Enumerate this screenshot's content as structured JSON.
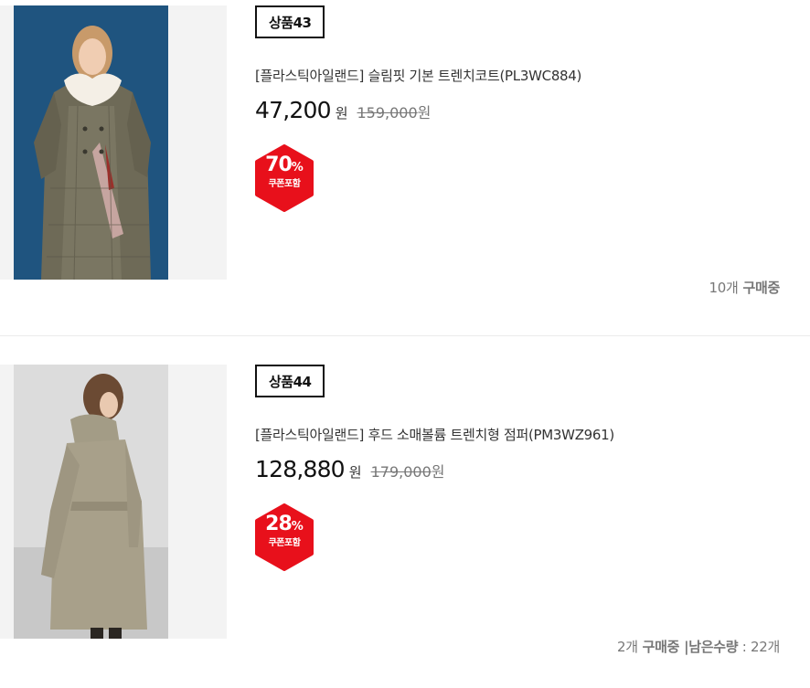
{
  "products": [
    {
      "badge": "상품43",
      "name": "[플라스틱아일랜드] 슬림핏 기본 트렌치코트(PL3WC884)",
      "price": "47,200",
      "currency": "원",
      "original_price": "159,000",
      "original_currency": "원",
      "discount_value": "70",
      "discount_unit": "%",
      "discount_note": "쿠폰포함",
      "sold_count": "10개",
      "sold_label": "구매중",
      "image_icon": "product-photo-trench-coat-plaid"
    },
    {
      "badge": "상품44",
      "name": "[플라스틱아일랜드] 후드 소매볼륨 트렌치형 점퍼(PM3WZ961)",
      "price": "128,880",
      "currency": "원",
      "original_price": "179,000",
      "original_currency": "원",
      "discount_value": "28",
      "discount_unit": "%",
      "discount_note": "쿠폰포함",
      "sold_count": "2개",
      "sold_label": "구매중",
      "stock_separator": " |",
      "stock_label": "남은수량",
      "stock_sep2": " : ",
      "stock_count": "22개",
      "image_icon": "product-photo-hooded-trench-jumper"
    }
  ],
  "colors": {
    "discount_badge": "#e8101b",
    "price": "#111111",
    "muted": "#777777",
    "border": "#111111"
  }
}
